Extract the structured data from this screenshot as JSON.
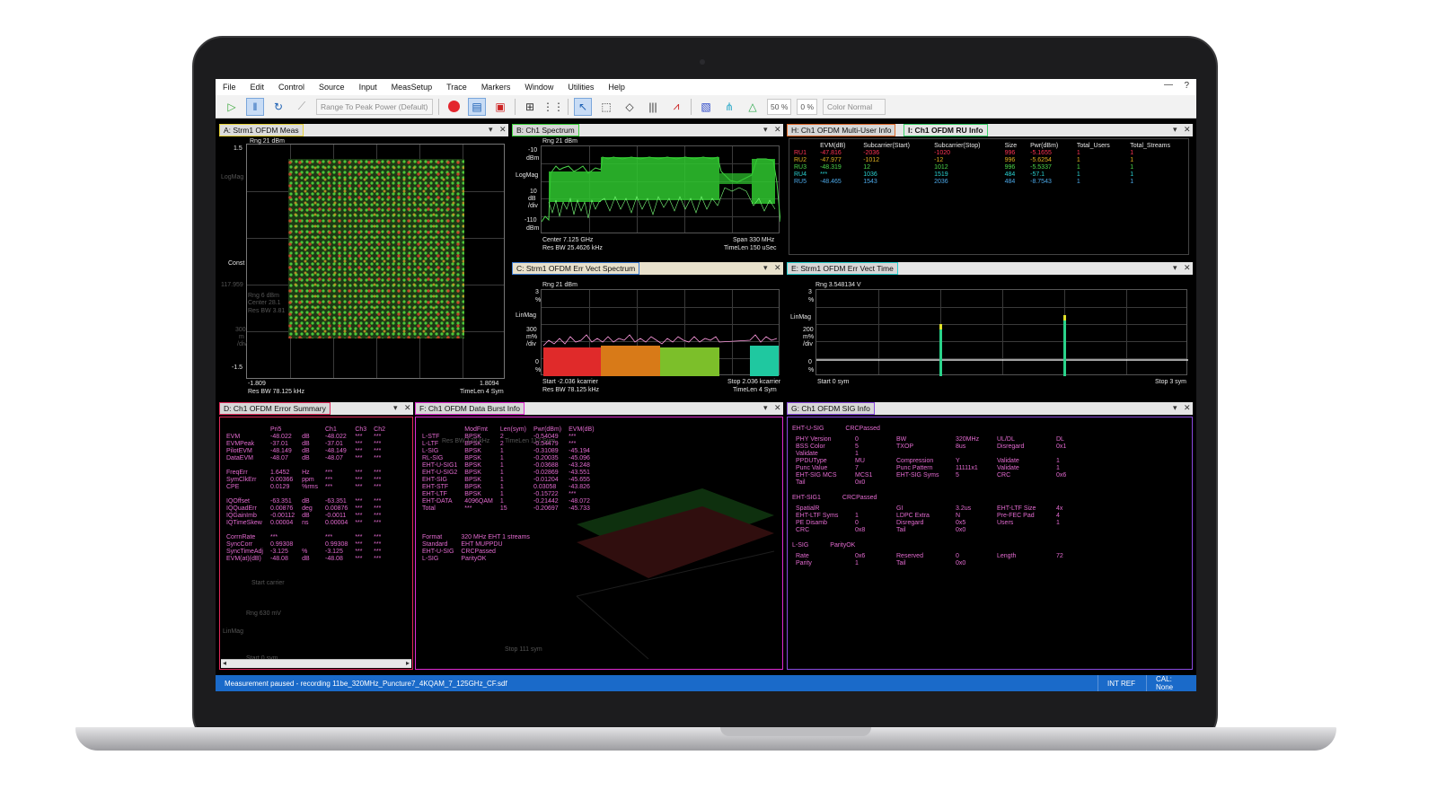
{
  "menu": [
    "File",
    "Edit",
    "Control",
    "Source",
    "Input",
    "MeasSetup",
    "Trace",
    "Markers",
    "Window",
    "Utilities",
    "Help"
  ],
  "window_controls": {
    "minimize": "—",
    "help": "?"
  },
  "toolbar": {
    "range_dropdown": "Range To Peak Power (Default)",
    "zoom_pct": "50 %",
    "opacity_pct": "0 %",
    "color_mode": "Color Normal",
    "icons": [
      "play-icon",
      "pause-icon",
      "restart-icon",
      "autorange-icon",
      "record-icon",
      "layout-icon",
      "grid-icon",
      "cursor-icon",
      "zoom-icon",
      "marker-icon"
    ]
  },
  "panels": {
    "A": {
      "title": "A: Strm1 OFDM Meas",
      "rng": "Rng 21 dBm",
      "ytop": "1.5",
      "ybot": "-1.5",
      "mode": "Const",
      "xleft": "-1.809",
      "xright": "1.8094",
      "footer_left": "Res BW 78.125 kHz",
      "footer_right": "TimeLen 4  Sym",
      "ghost_texts": [
        "LogMag",
        "117.959",
        "Center 28.1",
        "Res BW 3.81",
        "300",
        "m",
        "/div",
        "Rng 6 dBm"
      ]
    },
    "B": {
      "title": "B: Ch1 Spectrum",
      "rng": "Rng 21 dBm",
      "y_top": "-10",
      "y_top_unit": "dBm",
      "y_mode": "LogMag",
      "y_div": "10",
      "y_div_unit": "dB",
      "y_div_label": "/div",
      "y_bot": "-110",
      "y_bot_unit": "dBm",
      "center": "Center 7.125 GHz",
      "span": "Span 330 MHz",
      "res_bw": "Res BW 25.4626 kHz",
      "timelen": "TimeLen 150 uSec"
    },
    "C": {
      "title": "C: Strm1 OFDM Err Vect Spectrum",
      "rng": "Rng 21 dBm",
      "y_top": "3",
      "y_top_unit": "%",
      "y_mode": "LinMag",
      "y_div": "300",
      "y_div_unit": "m%",
      "y_div_label": "/div",
      "y_bot": "0",
      "y_bot_unit": "%",
      "start": "Start -2.036 kcarrier",
      "stop": "Stop 2.036 kcarrier",
      "res_bw": "Res BW 78.125 kHz",
      "timelen": "TimeLen 4  Sym"
    },
    "E": {
      "title": "E: Strm1 OFDM Err Vect Time",
      "rng": "Rng 3.548134  V",
      "y_top": "3",
      "y_top_unit": "%",
      "y_mode": "LinMag",
      "y_div": "200",
      "y_div_unit": "m%",
      "y_div_label": "/div",
      "y_bot": "0",
      "y_bot_unit": "%",
      "start": "Start 0  sym",
      "stop": "Stop 3  sym"
    },
    "H": {
      "title": "H: Ch1 OFDM Multi-User Info",
      "tab2": "I: Ch1 OFDM RU Info",
      "headers": [
        "EVM(dB)",
        "Subcarrier(Start)",
        "Subcarrier(Stop)",
        "Size",
        "Pwr(dBm)",
        "Total_Users",
        "Total_Streams"
      ],
      "rows": [
        [
          "RU1",
          "-47.816",
          "-2036",
          "-1020",
          "996",
          "-5.1655",
          "1",
          "1"
        ],
        [
          "RU2",
          "-47.977",
          "-1012",
          "-12",
          "996",
          "-5.6254",
          "1",
          "1"
        ],
        [
          "RU3",
          "-48.319",
          "12",
          "1012",
          "996",
          "-5.5337",
          "1",
          "1"
        ],
        [
          "RU4",
          "***",
          "1036",
          "1519",
          "484",
          "-57.1",
          "1",
          "1"
        ],
        [
          "RU5",
          "-48.465",
          "1543",
          "2036",
          "484",
          "-8.7543",
          "1",
          "1"
        ]
      ]
    },
    "D": {
      "title": "D: Ch1 OFDM Error Summary",
      "headers": [
        "",
        "Pri5",
        "",
        "Ch1",
        "Ch3",
        "Ch2"
      ],
      "rows": [
        [
          "EVM",
          "-48.022",
          "dB",
          "-48.022",
          "***",
          "***"
        ],
        [
          "EVMPeak",
          "-37.01",
          "dB",
          "-37.01",
          "***",
          "***"
        ],
        [
          "PilotEVM",
          "-48.149",
          "dB",
          "-48.149",
          "***",
          "***"
        ],
        [
          "DataEVM",
          "-48.07",
          "dB",
          "-48.07",
          "***",
          "***"
        ],
        [
          "",
          "",
          "",
          "",
          "",
          ""
        ],
        [
          "FreqErr",
          "1.6452",
          "Hz",
          "***",
          "***",
          "***"
        ],
        [
          "SymClkErr",
          "0.00366",
          "ppm",
          "***",
          "***",
          "***"
        ],
        [
          "CPE",
          "0.0129",
          "%rms",
          "***",
          "***",
          "***"
        ],
        [
          "",
          "",
          "",
          "",
          "",
          ""
        ],
        [
          "IQOffset",
          "-63.351",
          "dB",
          "-63.351",
          "***",
          "***"
        ],
        [
          "IQQuadErr",
          "0.00876",
          "deg",
          "0.00876",
          "***",
          "***"
        ],
        [
          "IQGainImb",
          "-0.00112",
          "dB",
          "-0.0011",
          "***",
          "***"
        ],
        [
          "IQTimeSkew",
          "0.00004",
          "ns",
          "0.00004",
          "***",
          "***"
        ],
        [
          "",
          "",
          "",
          "",
          "",
          ""
        ],
        [
          "CorrnRate",
          "***",
          "",
          "***",
          "***",
          "***"
        ],
        [
          "SyncCorr",
          "0.99308",
          "",
          "0.99308",
          "***",
          "***"
        ],
        [
          "SyncTimeAdj",
          "-3.125",
          "%",
          "-3.125",
          "***",
          "***"
        ],
        [
          "EVM(at)(dB)",
          "-48.08",
          "dB",
          "-48.08",
          "***",
          "***"
        ]
      ],
      "ghost": [
        "Start  carrier",
        "Rng 630 mV",
        "LinMag",
        "Start 0  sym"
      ]
    },
    "F": {
      "title": "F: Ch1 OFDM Data Burst Info",
      "headers": [
        "",
        "ModFmt",
        "Len(sym)",
        "Pwr(dBm)",
        "EVM(dB)"
      ],
      "rows": [
        [
          "L-STF",
          "BPSK",
          "2",
          "-0.54049",
          "***"
        ],
        [
          "L-LTF",
          "BPSK",
          "2",
          "-0.54479",
          "***"
        ],
        [
          "L-SIG",
          "BPSK",
          "1",
          "-0.31089",
          "-45.194"
        ],
        [
          "RL-SIG",
          "BPSK",
          "1",
          "-0.20035",
          "-45.096"
        ],
        [
          "EHT-U-SIG1",
          "BPSK",
          "1",
          "-0.03688",
          "-43.248"
        ],
        [
          "EHT-U-SIG2",
          "BPSK",
          "1",
          "-0.02869",
          "-43.551"
        ],
        [
          "EHT-SIG",
          "BPSK",
          "1",
          "-0.01204",
          "-45.655"
        ],
        [
          "EHT-STF",
          "BPSK",
          "1",
          "0.03058",
          "-43.826"
        ],
        [
          "EHT-LTF",
          "BPSK",
          "1",
          "-0.15722",
          "***"
        ],
        [
          "EHT-DATA",
          "4096QAM",
          "1",
          "-0.21442",
          "-48.072"
        ],
        [
          "Total",
          "***",
          "15",
          "-0.20697",
          "-45.733"
        ]
      ],
      "footer": [
        [
          "Format",
          "320 MHz EHT 1 streams"
        ],
        [
          "Standard",
          "EHT MUPPDU"
        ],
        [
          "EHT-U-SIG",
          "CRCPassed"
        ],
        [
          "L-SIG",
          "ParityOK"
        ]
      ],
      "ghost": [
        "Stop 111  sym",
        "Res BW 170 kHz",
        "TimeLen 112  Sym"
      ]
    },
    "G": {
      "title": "G: Ch1 OFDM SIG Info",
      "sections": [
        {
          "label": "EHT-U-SIG",
          "status": "CRCPassed",
          "items": [
            [
              "PHY Version",
              "0",
              "BW",
              "320MHz",
              "UL/DL",
              "DL"
            ],
            [
              "BSS Color",
              "5",
              "TXOP",
              "8us",
              "Disregard",
              "0x1"
            ],
            [
              "Validate",
              "1",
              "",
              "",
              "",
              ""
            ],
            [
              "PPDUType",
              "MU",
              "Compression",
              "Y",
              "Validate",
              "1"
            ],
            [
              "Punc Value",
              "7",
              "Punc Pattern",
              "11111x1",
              "Validate",
              "1"
            ],
            [
              "EHT-SIG MCS",
              "MCS1",
              "EHT-SIG Syms",
              "5",
              "CRC",
              "0x6"
            ],
            [
              "Tail",
              "0x0",
              "",
              "",
              "",
              ""
            ]
          ]
        },
        {
          "label": "EHT-SIG1",
          "status": "CRCPassed",
          "items": [
            [
              "SpatialR",
              "",
              "GI",
              "3.2us",
              "EHT-LTF Size",
              "4x"
            ],
            [
              "EHT-LTF Syms",
              "1",
              "LDPC Extra",
              "N",
              "Pre-FEC Pad",
              "4"
            ],
            [
              "PE Disamb",
              "0",
              "Disregard",
              "0x5",
              "Users",
              "1"
            ],
            [
              "CRC",
              "0x8",
              "Tail",
              "0x0",
              "",
              ""
            ]
          ]
        },
        {
          "label": "L-SIG",
          "status": "ParityOK",
          "items": [
            [
              "Rate",
              "0x6",
              "Reserved",
              "0",
              "Length",
              "72"
            ],
            [
              "Parity",
              "1",
              "Tail",
              "0x0",
              "",
              ""
            ]
          ]
        }
      ]
    }
  },
  "status": {
    "message": "Measurement paused - recording 11be_320MHz_Puncture7_4KQAM_7_125GHz_CF.sdf",
    "int_ref": "INT REF",
    "cal": "CAL: None"
  }
}
